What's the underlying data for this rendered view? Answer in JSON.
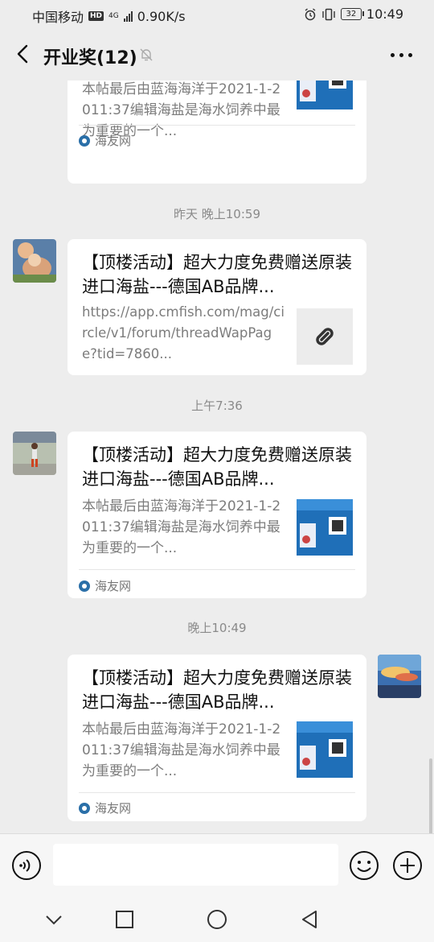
{
  "status_bar": {
    "carrier": "中国移动",
    "network_badge": "HD",
    "network_type": "4G",
    "speed": "0.90K/s",
    "battery_level": "32",
    "time": "10:49"
  },
  "header": {
    "title": "开业奖(12)",
    "icons": [
      "back-arrow-icon",
      "mute-bell-icon",
      "more-dots-icon"
    ]
  },
  "messages": [
    {
      "card": {
        "desc": "本帖最后由蓝海海洋于2021-1-2011:37编辑海盐是海水饲养中最为重要的一个...",
        "source": "海友网"
      }
    },
    {
      "timestamp": "昨天 晚上10:59",
      "card": {
        "title": "【顶楼活动】超大力度免费赠送原装进口海盐---德国AB品牌...",
        "desc": "https://app.cmfish.com/mag/circle/v1/forum/threadWapPage?tid=7860...",
        "thumb_icon": "link-icon"
      }
    },
    {
      "timestamp": "上午7:36",
      "card": {
        "title": "【顶楼活动】超大力度免费赠送原装进口海盐---德国AB品牌...",
        "desc": "本帖最后由蓝海海洋于2021-1-2011:37编辑海盐是海水饲养中最为重要的一个...",
        "source": "海友网"
      }
    },
    {
      "timestamp": "晚上10:49",
      "card": {
        "title": "【顶楼活动】超大力度免费赠送原装进口海盐---德国AB品牌...",
        "desc": "本帖最后由蓝海海洋于2021-1-2011:37编辑海盐是海水饲养中最为重要的一个...",
        "source": "海友网"
      }
    }
  ],
  "input_bar": {
    "placeholder": "",
    "icons": [
      "voice-icon",
      "emoji-icon",
      "plus-icon"
    ]
  },
  "nav_bar": {
    "icons": [
      "collapse-chevron-icon",
      "recent-apps-icon",
      "home-icon",
      "back-triangle-icon"
    ]
  },
  "colors": {
    "background": "#ededed",
    "card": "#ffffff",
    "source_brand": "#2a6fa8"
  }
}
